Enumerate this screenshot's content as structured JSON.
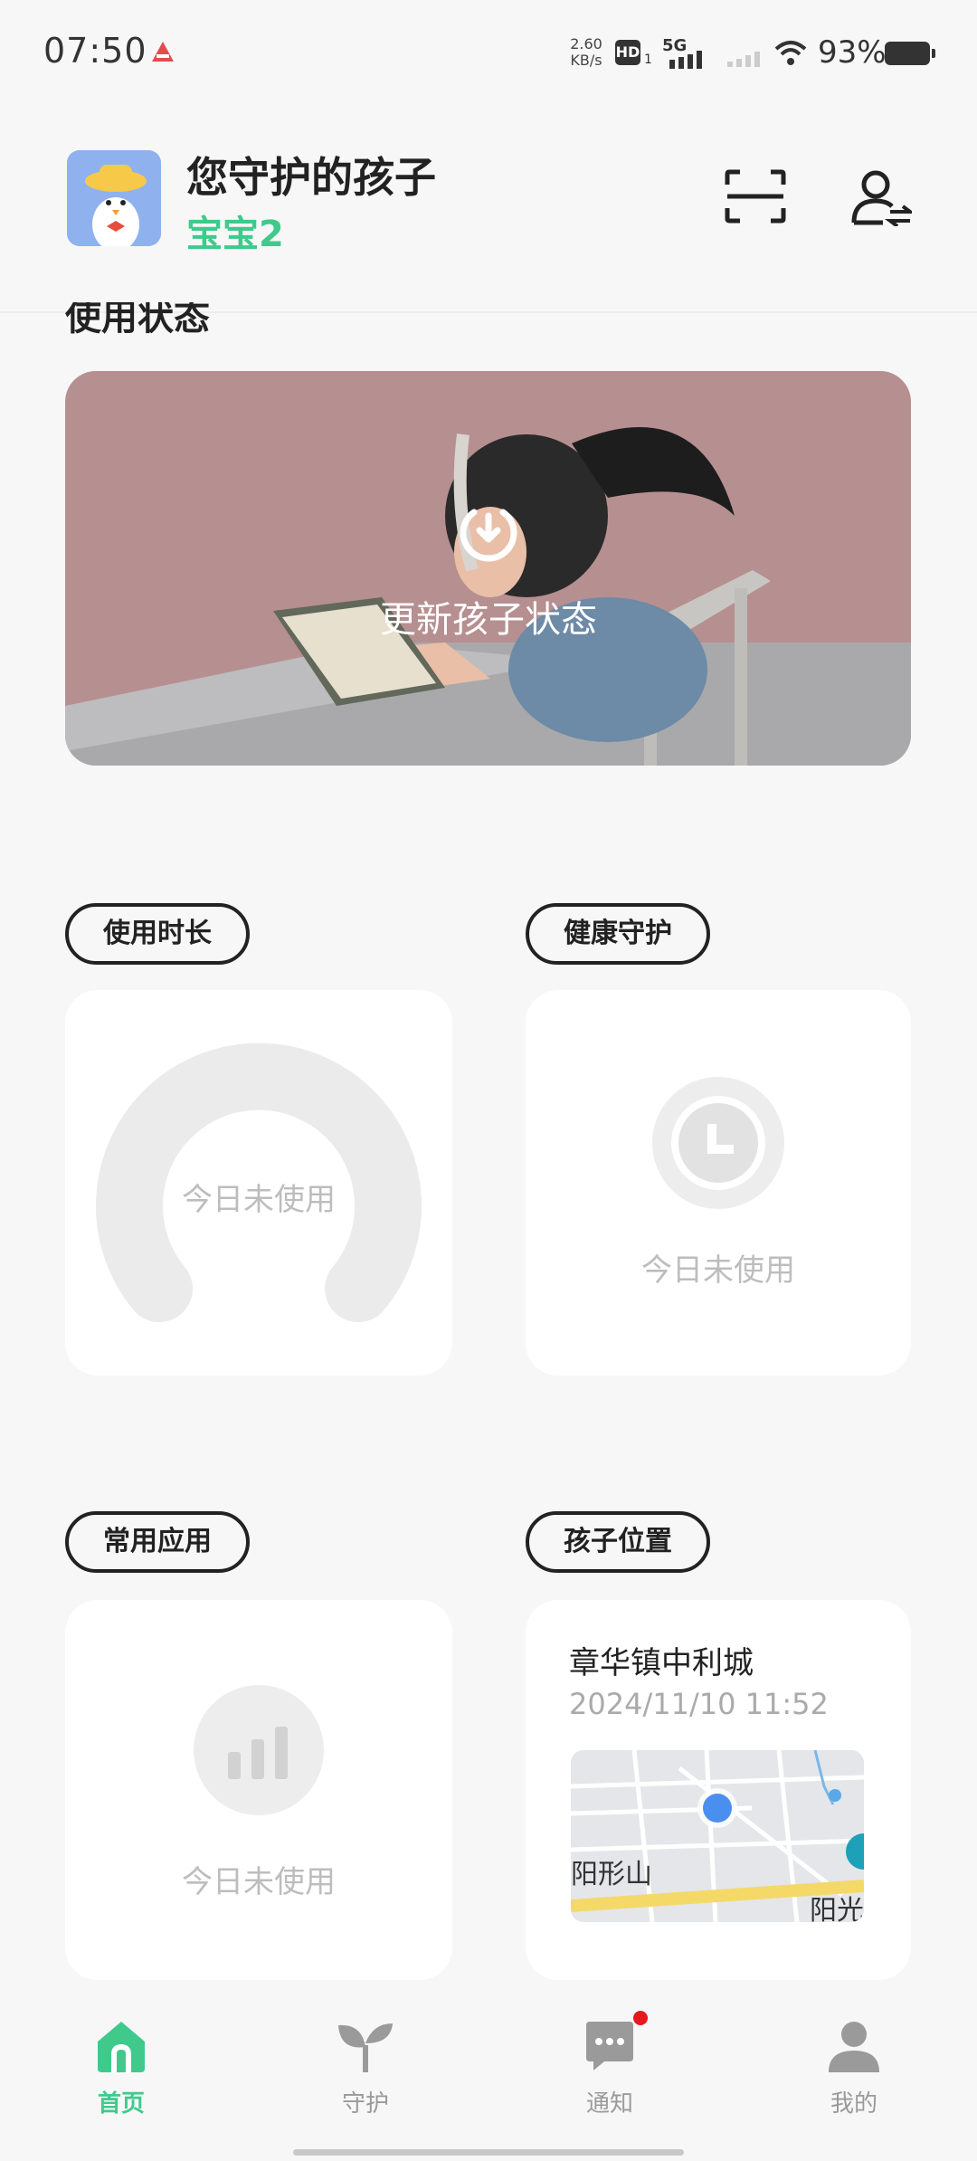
{
  "status_bar": {
    "time": "07:50",
    "speed_value": "2.60",
    "speed_unit": "KB/s",
    "hd": "HD",
    "hd_sub": "1",
    "network": "5G",
    "battery": "93%"
  },
  "header": {
    "title": "您守护的孩子",
    "child_name": "宝宝2"
  },
  "sections": {
    "peek_title": "使用状态",
    "banner_label": "更新孩子状态"
  },
  "cards": {
    "usage": {
      "chip": "使用时长",
      "empty": "今日未使用"
    },
    "health": {
      "chip": "健康守护",
      "empty": "今日未使用"
    },
    "apps": {
      "chip": "常用应用",
      "empty": "今日未使用"
    },
    "location": {
      "chip": "孩子位置",
      "place": "章华镇中利城",
      "time": "2024/11/10 11:52",
      "map_label_left": "阳形山",
      "map_label_right": "阳光"
    }
  },
  "nav": {
    "home": "首页",
    "guard": "守护",
    "notify": "通知",
    "mine": "我的"
  },
  "colors": {
    "accent": "#3fca8c",
    "banner": "#b68f91",
    "background": "#f7f7f7"
  }
}
